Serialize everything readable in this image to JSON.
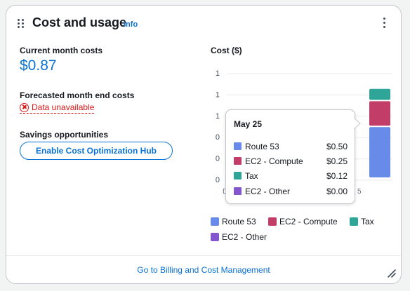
{
  "widget": {
    "title": "Cost and usage",
    "info_label": "Info"
  },
  "summary": {
    "current_label": "Current month costs",
    "current_value": "$0.87",
    "forecast_label": "Forecasted month end costs",
    "forecast_status": "Data unavailable",
    "savings_label": "Savings opportunities",
    "hub_button_label": "Enable Cost Optimization Hub"
  },
  "chart_data": {
    "type": "bar",
    "stacked": true,
    "ylabel": "Cost ($)",
    "y_tick_labels": [
      "0",
      "0",
      "0",
      "1",
      "1",
      "1"
    ],
    "ylim": [
      0,
      1
    ],
    "categories": [
      "May 25"
    ],
    "series": [
      {
        "name": "Route 53",
        "color": "#688ae8",
        "values": [
          0.5
        ]
      },
      {
        "name": "EC2 - Compute",
        "color": "#c33d69",
        "values": [
          0.25
        ]
      },
      {
        "name": "Tax",
        "color": "#2ea597",
        "values": [
          0.12
        ]
      },
      {
        "name": "EC2 - Other",
        "color": "#8456ce",
        "values": [
          0.0
        ]
      }
    ]
  },
  "tooltip": {
    "title": "May 25",
    "rows": [
      {
        "name": "Route 53",
        "value": "$0.50"
      },
      {
        "name": "EC2 - Compute",
        "value": "$0.25"
      },
      {
        "name": "Tax",
        "value": "$0.12"
      },
      {
        "name": "EC2 - Other",
        "value": "$0.00"
      }
    ]
  },
  "legend": {
    "items": [
      "Route 53",
      "EC2 - Compute",
      "Tax",
      "EC2 - Other"
    ]
  },
  "footer": {
    "link_label": "Go to Billing and Cost Management"
  }
}
